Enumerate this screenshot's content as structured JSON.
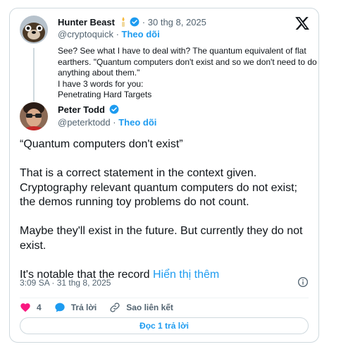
{
  "parent_tweet": {
    "author_name": "Hunter Beast",
    "handle": "@cryptoquick",
    "separator": "·",
    "date": "30 thg 8, 2025",
    "follow_label": "Theo dõi",
    "lines": [
      "See? See what I have to deal with? The quantum equivalent of flat",
      "earthers. \"Quantum computers don't exist and so we don't need to do",
      "anything about them.\"",
      "I have 3 words for you:",
      "Penetrating Hard Targets"
    ]
  },
  "main_tweet": {
    "author_name": "Peter Todd",
    "handle": "@peterktodd",
    "separator": "·",
    "follow_label": "Theo dõi",
    "paragraphs": [
      "“Quantum computers don't exist”",
      "That is a correct statement in the context given. Cryptography relevant quantum computers do not exist; the demos running toy problems do not count.",
      "Maybe they'll exist in the future. But currently they do not exist."
    ],
    "last_paragraph_text": "It's notable that the record ",
    "show_more_label": "Hiển thị thêm",
    "timestamp": "3:09 SA · 31 thg 8, 2025"
  },
  "actions": {
    "like_count": "4",
    "reply_label": "Trả lời",
    "copy_link_label": "Sao liên kết"
  },
  "read_replies_label": "Đọc 1 trả lời",
  "colors": {
    "accent": "#1d9bf0",
    "like": "#f91880",
    "muted": "#536471",
    "border": "#cfd9de"
  },
  "icons": {
    "brand": "x-logo-icon",
    "verified": "verified-badge-icon",
    "info": "info-icon",
    "like": "heart-icon",
    "reply": "reply-bubble-icon",
    "link": "link-icon",
    "status": "candle-icon"
  }
}
